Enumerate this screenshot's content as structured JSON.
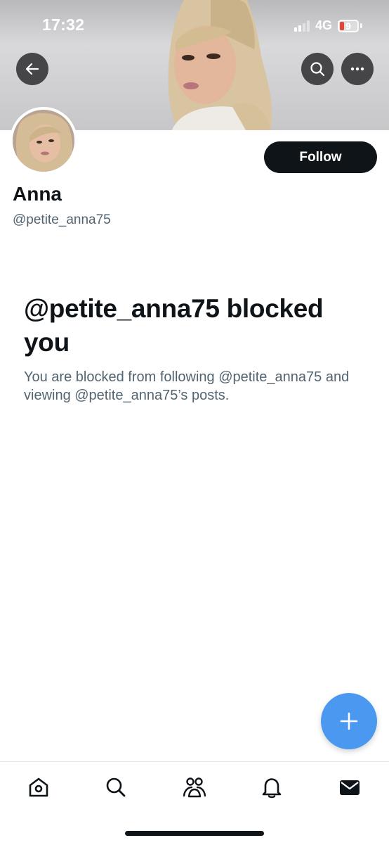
{
  "status_bar": {
    "time": "17:32",
    "network": "4G",
    "battery": "9"
  },
  "profile": {
    "display_name": "Anna",
    "handle": "@petite_anna75",
    "follow_label": "Follow"
  },
  "blocked": {
    "title": "@petite_anna75 blocked you",
    "description": "You are blocked from following @petite_anna75 and viewing @petite_anna75’s posts."
  },
  "fab": {
    "icon": "plus-icon"
  },
  "tabs": [
    {
      "icon": "home-icon"
    },
    {
      "icon": "search-icon"
    },
    {
      "icon": "communities-icon"
    },
    {
      "icon": "notifications-icon"
    },
    {
      "icon": "messages-icon"
    }
  ],
  "colors": {
    "accent": "#4b98f0",
    "text": "#0f1419",
    "secondary": "#536471",
    "battery_low": "#e0463c"
  }
}
